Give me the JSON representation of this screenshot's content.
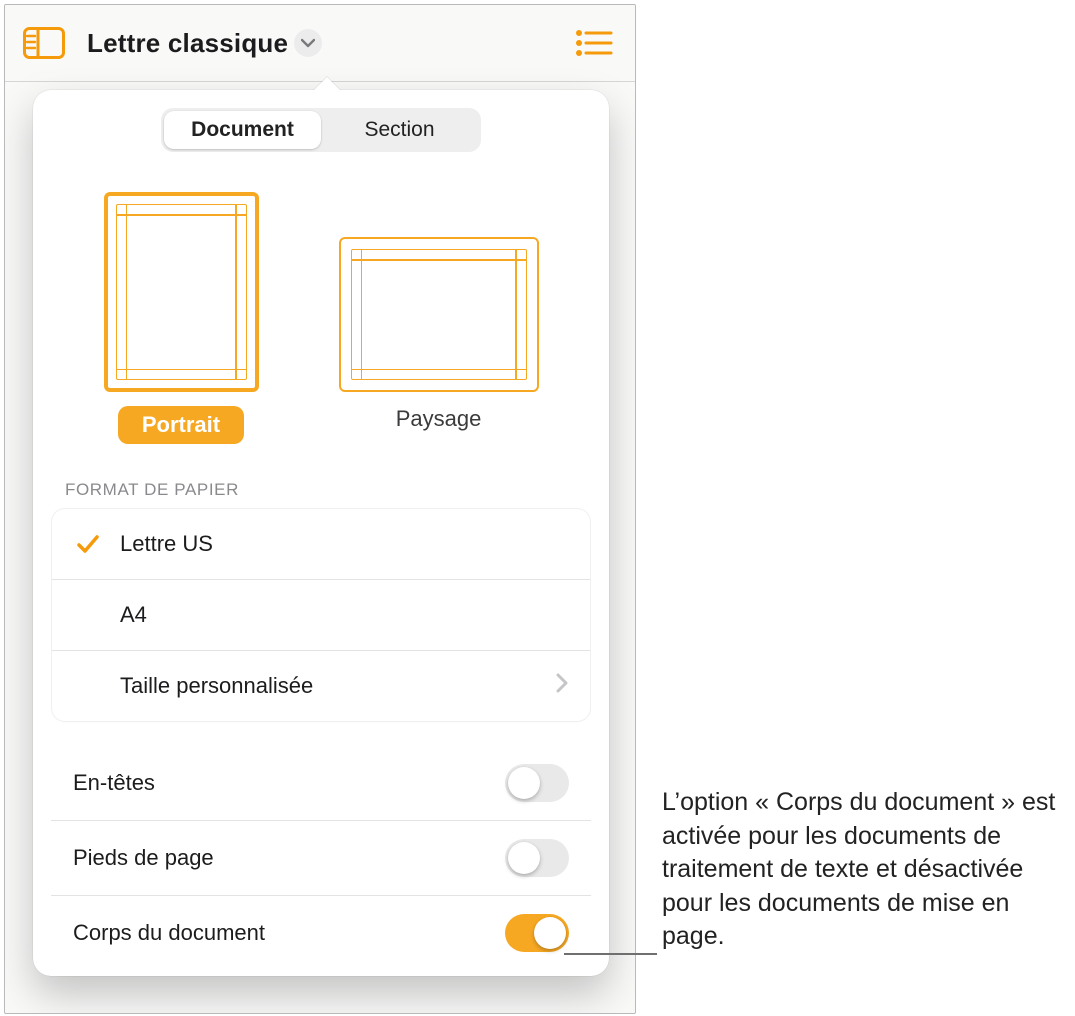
{
  "toolbar": {
    "title": "Lettre classique"
  },
  "popover": {
    "tabs": {
      "document": "Document",
      "section": "Section",
      "selected": "document"
    },
    "orientation": {
      "portrait_label": "Portrait",
      "landscape_label": "Paysage",
      "selected": "portrait"
    },
    "paper_section_label": "Format de papier",
    "paper_options": [
      {
        "label": "Lettre US",
        "selected": true,
        "disclosure": false
      },
      {
        "label": "A4",
        "selected": false,
        "disclosure": false
      },
      {
        "label": "Taille personnalisée",
        "selected": false,
        "disclosure": true
      }
    ],
    "toggles": [
      {
        "label": "En-têtes",
        "on": false
      },
      {
        "label": "Pieds de page",
        "on": false
      },
      {
        "label": "Corps du document",
        "on": true
      }
    ]
  },
  "callout": "L’option « Corps du document » est activée pour les documents de traitement de texte et désactivée pour les documents de mise en page.",
  "colors": {
    "accent": "#F7A823"
  }
}
